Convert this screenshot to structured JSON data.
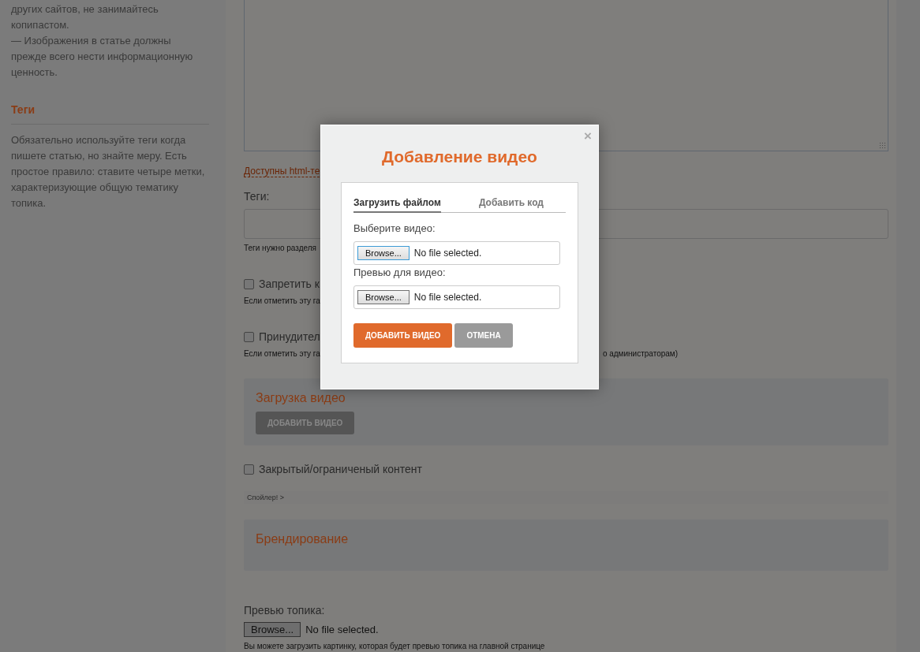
{
  "sidebar": {
    "paragraphs": [
      "других сайтов, не занимайтесь копипастом.",
      "— Изображения в статье должны прежде всего нести информационную ценность."
    ],
    "section_title": "Теги",
    "section_text": "Обязательно используйте теги когда пишете статью, но знайте меру. Есть простое правило: ставите четыре метки, характеризующие общую тематику топика."
  },
  "editor": {
    "html_tags_link": "Доступны html-те",
    "tags_label": "Теги:",
    "tags_hint": "Теги нужно разделя",
    "options": [
      {
        "label": "Запретить к",
        "checked": false,
        "hint": "Если отметить эту га"
      },
      {
        "label": "Принудител",
        "checked": false,
        "hint": "Если отметить эту га",
        "hint_tail": "о администраторам)"
      }
    ],
    "video_panel": {
      "title": "Загрузка видео",
      "button": "ДОБАВИТЬ ВИДЕО"
    },
    "restricted": {
      "label": "Закрытый/ограниченый контент",
      "checked": false
    },
    "spoiler": "Спойлер! >",
    "branding_panel": {
      "title": "Брендирование"
    },
    "preview": {
      "label": "Превью топика:",
      "browse": "Browse...",
      "status": "No file selected.",
      "hint": "Вы можете загрузить картинку, которая будет превью топика на главной странице"
    }
  },
  "dialog": {
    "title": "Добавление видео",
    "close": "×",
    "tabs": [
      {
        "label": "Загрузить файлом",
        "selected": true
      },
      {
        "label": "Добавить код",
        "selected": false
      }
    ],
    "fields": [
      {
        "label": "Выберите видео:",
        "browse": "Browse...",
        "status": "No file selected.",
        "focused": true
      },
      {
        "label": "Превью для видео:",
        "browse": "Browse...",
        "status": "No file selected.",
        "focused": false
      }
    ],
    "buttons": [
      {
        "label": "ДОБАВИТЬ ВИДЕО",
        "kind": "primary"
      },
      {
        "label": "ОТМЕНА",
        "kind": "secondary"
      }
    ]
  }
}
